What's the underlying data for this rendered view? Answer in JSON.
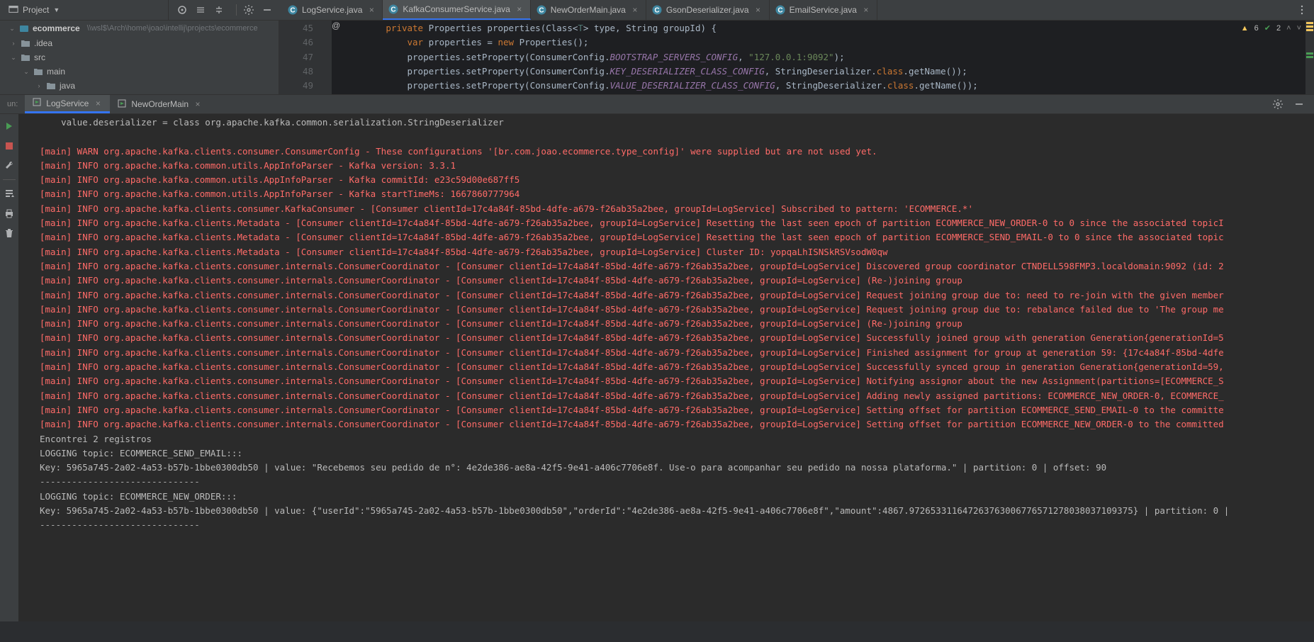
{
  "topbar": {
    "project_label": "Project"
  },
  "tabs": [
    {
      "icon": "C",
      "label": "LogService.java",
      "active": false
    },
    {
      "icon": "C",
      "label": "KafkaConsumerService.java",
      "active": true
    },
    {
      "icon": "C",
      "label": "NewOrderMain.java",
      "active": false
    },
    {
      "icon": "C",
      "label": "GsonDeserializer.java",
      "active": false
    },
    {
      "icon": "C",
      "label": "EmailService.java",
      "active": false
    }
  ],
  "tree": {
    "root": "ecommerce",
    "root_path": "\\\\wsl$\\Arch\\home\\joao\\intellij\\projects\\ecommerce",
    "items": [
      {
        "depth": 0,
        "arrow": ">",
        "icon": "folder",
        "label": ".idea"
      },
      {
        "depth": 0,
        "arrow": "v",
        "icon": "folder",
        "label": "src"
      },
      {
        "depth": 1,
        "arrow": "v",
        "icon": "folder",
        "label": "main"
      },
      {
        "depth": 2,
        "arrow": ">",
        "icon": "folder",
        "label": "java"
      }
    ]
  },
  "editor": {
    "line_start": 45,
    "warnings": "6",
    "checks": "2",
    "lines": [
      {
        "no": "45",
        "at": "@",
        "raw": [
          {
            "t": "        ",
            "c": ""
          },
          {
            "t": "private ",
            "c": "k-keyword"
          },
          {
            "t": "Properties ",
            "c": ""
          },
          {
            "t": "properties",
            "c": "k-method"
          },
          {
            "t": "(Class<",
            "c": ""
          },
          {
            "t": "T",
            "c": "k-generic"
          },
          {
            "t": "> type, String groupId) {",
            "c": ""
          }
        ]
      },
      {
        "no": "46",
        "raw": [
          {
            "t": "            ",
            "c": ""
          },
          {
            "t": "var ",
            "c": "k-keyword"
          },
          {
            "t": "properties = ",
            "c": ""
          },
          {
            "t": "new ",
            "c": "k-keyword"
          },
          {
            "t": "Properties();",
            "c": ""
          }
        ]
      },
      {
        "no": "47",
        "raw": [
          {
            "t": "            properties.setProperty(ConsumerConfig.",
            "c": ""
          },
          {
            "t": "BOOTSTRAP_SERVERS_CONFIG",
            "c": "k-static"
          },
          {
            "t": ", ",
            "c": ""
          },
          {
            "t": "\"127.0.0.1:9092\"",
            "c": "k-string"
          },
          {
            "t": ");",
            "c": ""
          }
        ]
      },
      {
        "no": "48",
        "raw": [
          {
            "t": "            properties.setProperty(ConsumerConfig.",
            "c": ""
          },
          {
            "t": "KEY_DESERIALIZER_CLASS_CONFIG",
            "c": "k-static"
          },
          {
            "t": ", StringDeserializer.",
            "c": ""
          },
          {
            "t": "class",
            "c": "k-keyword"
          },
          {
            "t": ".getName());",
            "c": ""
          }
        ]
      },
      {
        "no": "49",
        "raw": [
          {
            "t": "            properties.setProperty(ConsumerConfig.",
            "c": ""
          },
          {
            "t": "VALUE_DESERIALIZER_CLASS_CONFIG",
            "c": "k-static"
          },
          {
            "t": ", StringDeserializer.",
            "c": ""
          },
          {
            "t": "class",
            "c": "k-keyword"
          },
          {
            "t": ".getName());",
            "c": ""
          }
        ]
      }
    ]
  },
  "run": {
    "label": "un:",
    "tabs": [
      {
        "label": "LogService",
        "active": true
      },
      {
        "label": "NewOrderMain",
        "active": false
      }
    ],
    "console_lines": [
      {
        "c": "c-indent",
        "t": "    value.deserializer = class org.apache.kafka.common.serialization.StringDeserializer"
      },
      {
        "c": "",
        "t": ""
      },
      {
        "c": "c-red",
        "t": "[main] WARN org.apache.kafka.clients.consumer.ConsumerConfig - These configurations '[br.com.joao.ecommerce.type_config]' were supplied but are not used yet."
      },
      {
        "c": "c-red",
        "t": "[main] INFO org.apache.kafka.common.utils.AppInfoParser - Kafka version: 3.3.1"
      },
      {
        "c": "c-red",
        "t": "[main] INFO org.apache.kafka.common.utils.AppInfoParser - Kafka commitId: e23c59d00e687ff5"
      },
      {
        "c": "c-red",
        "t": "[main] INFO org.apache.kafka.common.utils.AppInfoParser - Kafka startTimeMs: 1667860777964"
      },
      {
        "c": "c-red",
        "t": "[main] INFO org.apache.kafka.clients.consumer.KafkaConsumer - [Consumer clientId=17c4a84f-85bd-4dfe-a679-f26ab35a2bee, groupId=LogService] Subscribed to pattern: 'ECOMMERCE.*'"
      },
      {
        "c": "c-red",
        "t": "[main] INFO org.apache.kafka.clients.Metadata - [Consumer clientId=17c4a84f-85bd-4dfe-a679-f26ab35a2bee, groupId=LogService] Resetting the last seen epoch of partition ECOMMERCE_NEW_ORDER-0 to 0 since the associated topicI"
      },
      {
        "c": "c-red",
        "t": "[main] INFO org.apache.kafka.clients.Metadata - [Consumer clientId=17c4a84f-85bd-4dfe-a679-f26ab35a2bee, groupId=LogService] Resetting the last seen epoch of partition ECOMMERCE_SEND_EMAIL-0 to 0 since the associated topic"
      },
      {
        "c": "c-red",
        "t": "[main] INFO org.apache.kafka.clients.Metadata - [Consumer clientId=17c4a84f-85bd-4dfe-a679-f26ab35a2bee, groupId=LogService] Cluster ID: yopqaLhISNSkRSVsodW0qw"
      },
      {
        "c": "c-red",
        "t": "[main] INFO org.apache.kafka.clients.consumer.internals.ConsumerCoordinator - [Consumer clientId=17c4a84f-85bd-4dfe-a679-f26ab35a2bee, groupId=LogService] Discovered group coordinator CTNDELL598FMP3.localdomain:9092 (id: 2"
      },
      {
        "c": "c-red",
        "t": "[main] INFO org.apache.kafka.clients.consumer.internals.ConsumerCoordinator - [Consumer clientId=17c4a84f-85bd-4dfe-a679-f26ab35a2bee, groupId=LogService] (Re-)joining group"
      },
      {
        "c": "c-red",
        "t": "[main] INFO org.apache.kafka.clients.consumer.internals.ConsumerCoordinator - [Consumer clientId=17c4a84f-85bd-4dfe-a679-f26ab35a2bee, groupId=LogService] Request joining group due to: need to re-join with the given member"
      },
      {
        "c": "c-red",
        "t": "[main] INFO org.apache.kafka.clients.consumer.internals.ConsumerCoordinator - [Consumer clientId=17c4a84f-85bd-4dfe-a679-f26ab35a2bee, groupId=LogService] Request joining group due to: rebalance failed due to 'The group me"
      },
      {
        "c": "c-red",
        "t": "[main] INFO org.apache.kafka.clients.consumer.internals.ConsumerCoordinator - [Consumer clientId=17c4a84f-85bd-4dfe-a679-f26ab35a2bee, groupId=LogService] (Re-)joining group"
      },
      {
        "c": "c-red",
        "t": "[main] INFO org.apache.kafka.clients.consumer.internals.ConsumerCoordinator - [Consumer clientId=17c4a84f-85bd-4dfe-a679-f26ab35a2bee, groupId=LogService] Successfully joined group with generation Generation{generationId=5"
      },
      {
        "c": "c-red",
        "t": "[main] INFO org.apache.kafka.clients.consumer.internals.ConsumerCoordinator - [Consumer clientId=17c4a84f-85bd-4dfe-a679-f26ab35a2bee, groupId=LogService] Finished assignment for group at generation 59: {17c4a84f-85bd-4dfe"
      },
      {
        "c": "c-red",
        "t": "[main] INFO org.apache.kafka.clients.consumer.internals.ConsumerCoordinator - [Consumer clientId=17c4a84f-85bd-4dfe-a679-f26ab35a2bee, groupId=LogService] Successfully synced group in generation Generation{generationId=59,"
      },
      {
        "c": "c-red",
        "t": "[main] INFO org.apache.kafka.clients.consumer.internals.ConsumerCoordinator - [Consumer clientId=17c4a84f-85bd-4dfe-a679-f26ab35a2bee, groupId=LogService] Notifying assignor about the new Assignment(partitions=[ECOMMERCE_S"
      },
      {
        "c": "c-red",
        "t": "[main] INFO org.apache.kafka.clients.consumer.internals.ConsumerCoordinator - [Consumer clientId=17c4a84f-85bd-4dfe-a679-f26ab35a2bee, groupId=LogService] Adding newly assigned partitions: ECOMMERCE_NEW_ORDER-0, ECOMMERCE_"
      },
      {
        "c": "c-red",
        "t": "[main] INFO org.apache.kafka.clients.consumer.internals.ConsumerCoordinator - [Consumer clientId=17c4a84f-85bd-4dfe-a679-f26ab35a2bee, groupId=LogService] Setting offset for partition ECOMMERCE_SEND_EMAIL-0 to the committe"
      },
      {
        "c": "c-red",
        "t": "[main] INFO org.apache.kafka.clients.consumer.internals.ConsumerCoordinator - [Consumer clientId=17c4a84f-85bd-4dfe-a679-f26ab35a2bee, groupId=LogService] Setting offset for partition ECOMMERCE_NEW_ORDER-0 to the committed"
      },
      {
        "c": "c-white",
        "t": "Encontrei 2 registros"
      },
      {
        "c": "c-white",
        "t": "LOGGING topic: ECOMMERCE_SEND_EMAIL:::"
      },
      {
        "c": "c-white",
        "t": "Key: 5965a745-2a02-4a53-b57b-1bbe0300db50 | value: \"Recebemos seu pedido de n°: 4e2de386-ae8a-42f5-9e41-a406c7706e8f. Use-o para acompanhar seu pedido na nossa plataforma.\" | partition: 0 | offset: 90"
      },
      {
        "c": "dots",
        "t": "------------------------------"
      },
      {
        "c": "c-white",
        "t": "LOGGING topic: ECOMMERCE_NEW_ORDER:::"
      },
      {
        "c": "c-white",
        "t": "Key: 5965a745-2a02-4a53-b57b-1bbe0300db50 | value: {\"userId\":\"5965a745-2a02-4a53-b57b-1bbe0300db50\",\"orderId\":\"4e2de386-ae8a-42f5-9e41-a406c7706e8f\",\"amount\":4867.972653311647263763006776571278038037109375} | partition: 0 | "
      },
      {
        "c": "dots",
        "t": "------------------------------"
      }
    ]
  }
}
